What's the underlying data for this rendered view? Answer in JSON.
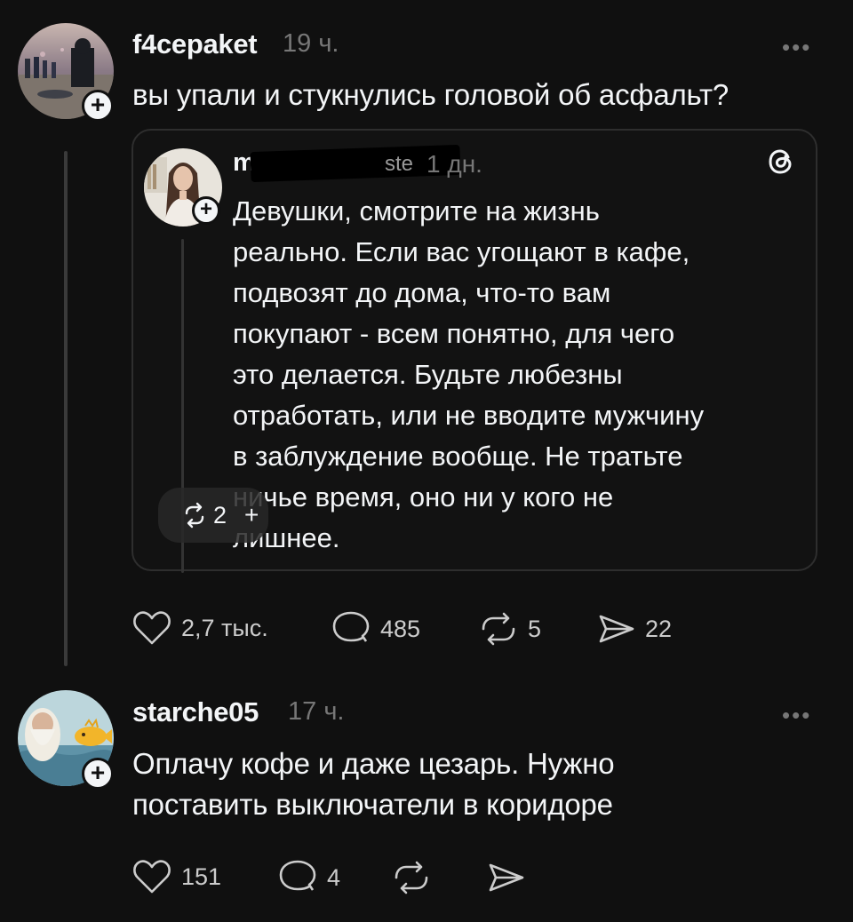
{
  "posts": [
    {
      "username": "f4cepaket",
      "time": "19 ч.",
      "more_label": "•••",
      "text": "вы упали и стукнулись головой об асфальт?",
      "actions": {
        "likes": "2,7 тыс.",
        "replies": "485",
        "reposts": "5",
        "shares": "22"
      }
    },
    {
      "username": "starche05",
      "time": "17 ч.",
      "more_label": "•••",
      "text_lines": [
        "Оплачу кофе и даже цезарь. Нужно",
        "поставить выключатели в коридоре"
      ],
      "actions": {
        "likes": "151",
        "replies": "4"
      }
    }
  ],
  "quoted_post": {
    "username_visible": "m",
    "username_tail": "ste",
    "time": "1 дн.",
    "text_lines": [
      "Девушки, смотрите на жизнь",
      "реально. Если вас угощают в кафе,",
      "подвозят до дома, что-то вам",
      "покупают - всем понятно, для чего",
      "это делается. Будьте любезны",
      "отработать, или не вводите мужчину",
      "в заблуждение вообще. Не тратьте",
      "ничье время, оно ни у кого не",
      "лишнее."
    ],
    "overlay_repost_count": "2"
  },
  "plus_symbol": "+",
  "colors": {
    "background": "#101010",
    "text": "#f3f5f7",
    "muted": "#777777",
    "divider": "#3a3a3a"
  }
}
